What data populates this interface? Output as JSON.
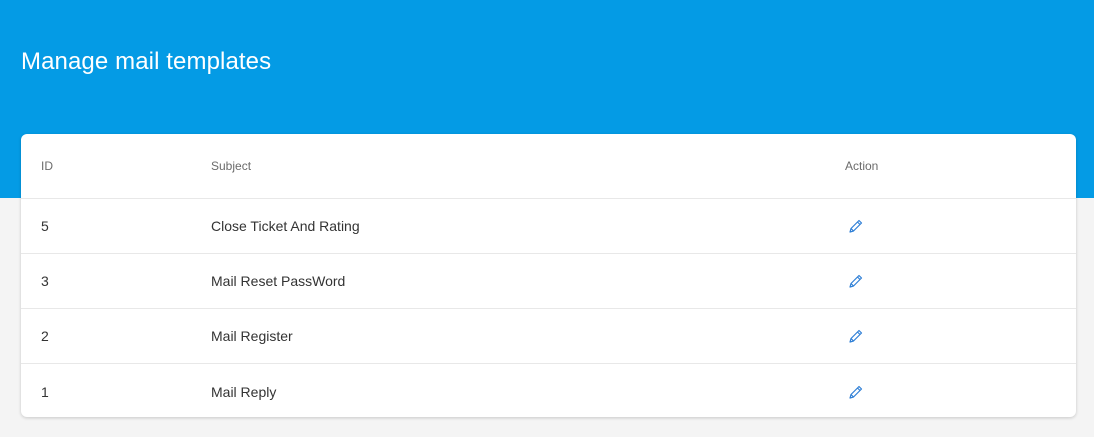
{
  "header": {
    "title": "Manage mail templates",
    "background_color": "#049be5"
  },
  "table": {
    "columns": {
      "id": "ID",
      "subject": "Subject",
      "action": "Action"
    },
    "rows": [
      {
        "id": "5",
        "subject": "Close Ticket And Rating",
        "action_icon": "edit-pencil-icon"
      },
      {
        "id": "3",
        "subject": "Mail Reset PassWord",
        "action_icon": "edit-pencil-icon"
      },
      {
        "id": "2",
        "subject": "Mail Register",
        "action_icon": "edit-pencil-icon"
      },
      {
        "id": "1",
        "subject": "Mail Reply",
        "action_icon": "edit-pencil-icon"
      }
    ],
    "icon_color": "#2f7fd6"
  }
}
